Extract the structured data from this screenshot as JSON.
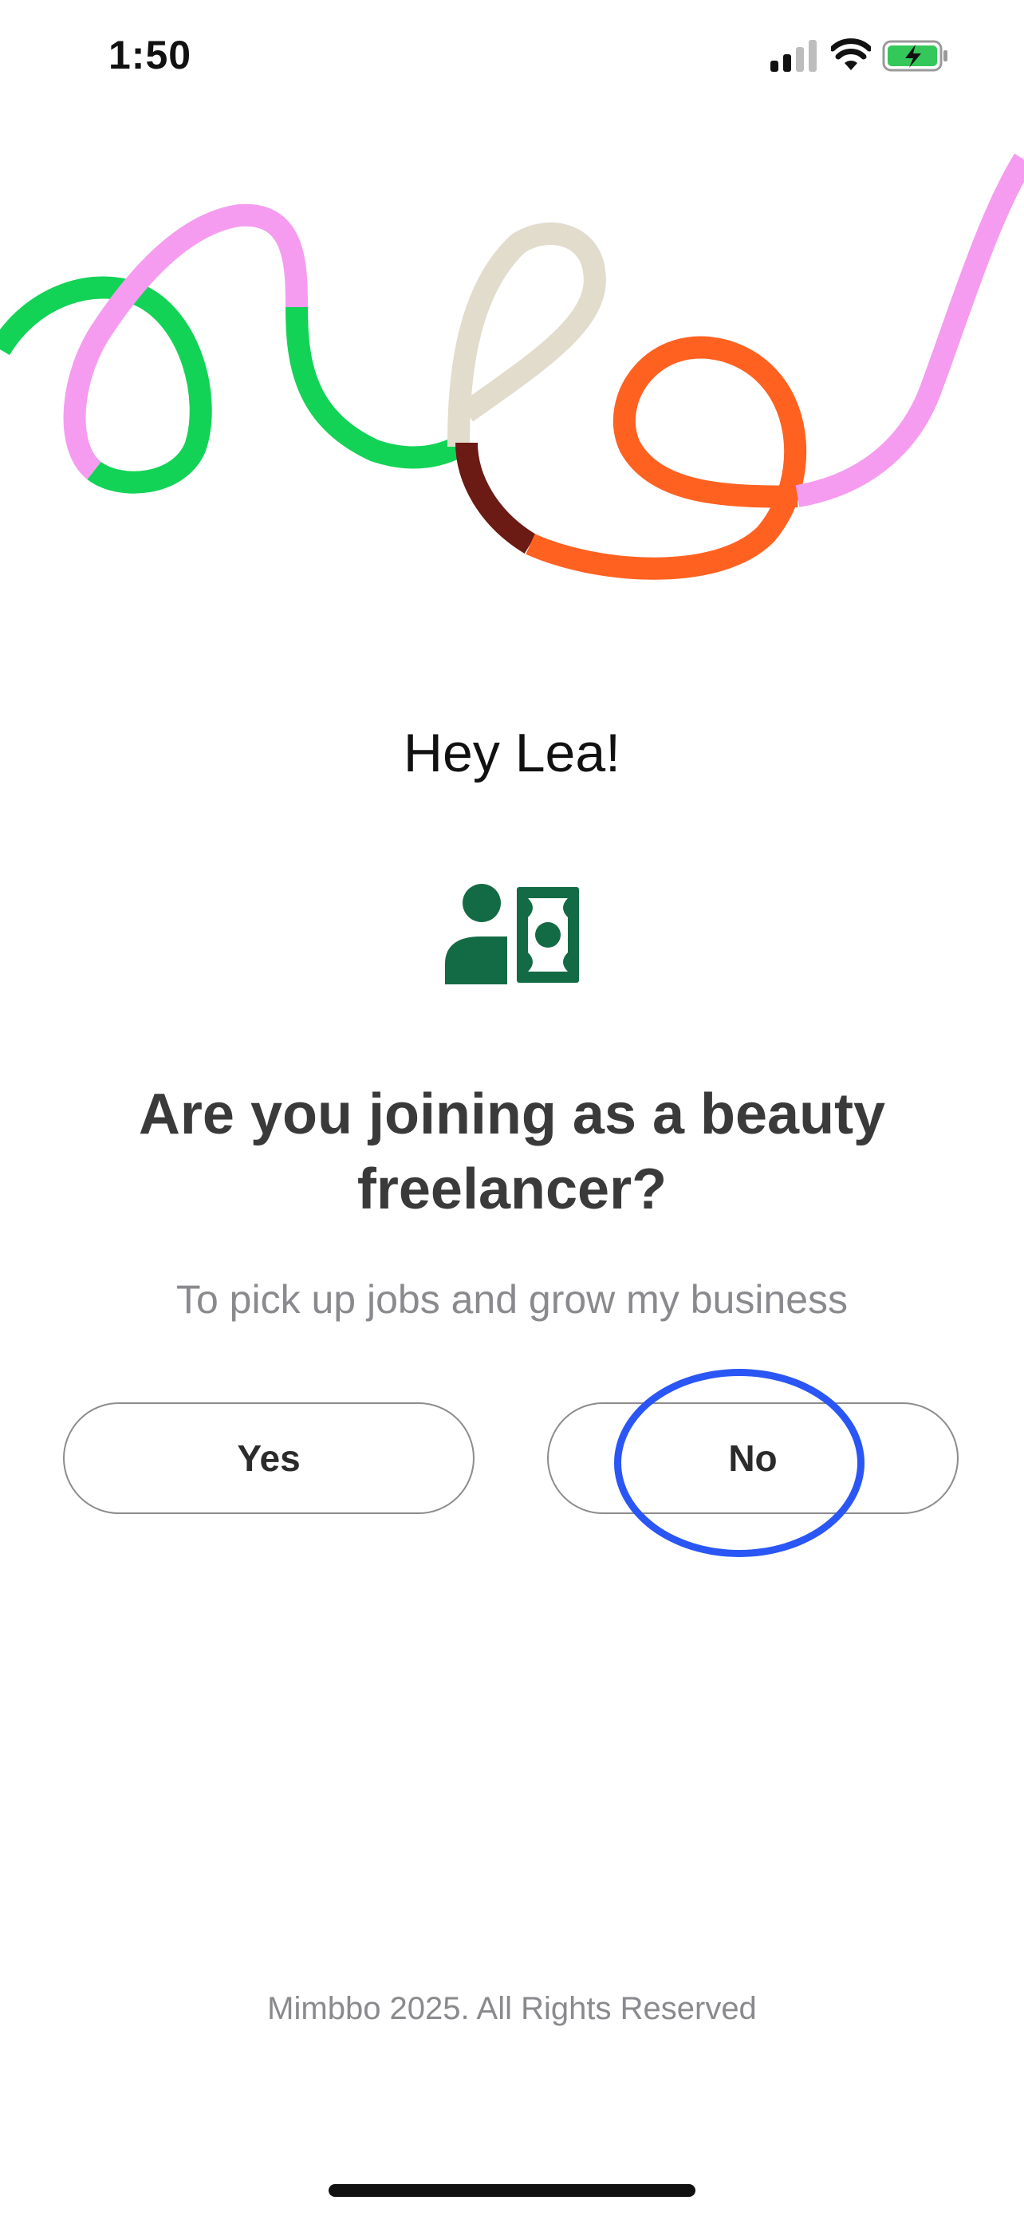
{
  "status_bar": {
    "time": "1:50",
    "icons": [
      "cellular-signal-icon",
      "wifi-icon",
      "battery-charging-icon"
    ]
  },
  "screen": {
    "greeting": "Hey Lea!",
    "icon": "freelancer-payment-icon",
    "question": "Are you joining as a beauty freelancer?",
    "subtitle": "To pick up jobs and grow my business"
  },
  "choices": {
    "yes_label": "Yes",
    "no_label": "No"
  },
  "footer": {
    "copyright": "Mimbbo 2025. All Rights Reserved"
  },
  "colors": {
    "brand_green": "#136b45",
    "ribbon_pink": "#f59cf0",
    "ribbon_green": "#13d356",
    "ribbon_beige": "#e2dccd",
    "ribbon_maroon": "#6b1a14",
    "ribbon_orange": "#ff6121",
    "highlight_blue": "#2a56f5"
  }
}
